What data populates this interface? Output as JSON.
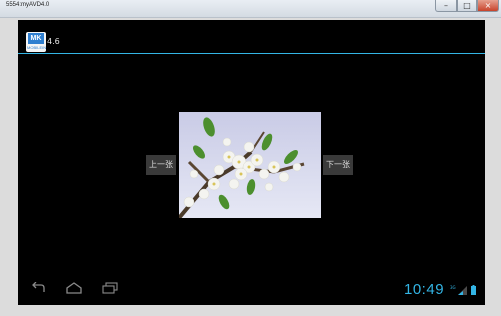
{
  "window": {
    "title": "5554:myAVD4.0",
    "minimize": "–",
    "maximize": "□",
    "close": "×"
  },
  "app": {
    "icon_text": "MK",
    "icon_subtext": "MOBILEIN",
    "title": "4.6"
  },
  "gallery": {
    "prev_label": "上一张",
    "next_label": "下一张",
    "image_subject": "white blossoms on branch against pale sky"
  },
  "system_bar": {
    "back_icon": "back-icon",
    "home_icon": "home-icon",
    "recents_icon": "recent-apps-icon",
    "time": "10:49",
    "signal_label": "3G",
    "accent_color": "#33b5e5"
  }
}
